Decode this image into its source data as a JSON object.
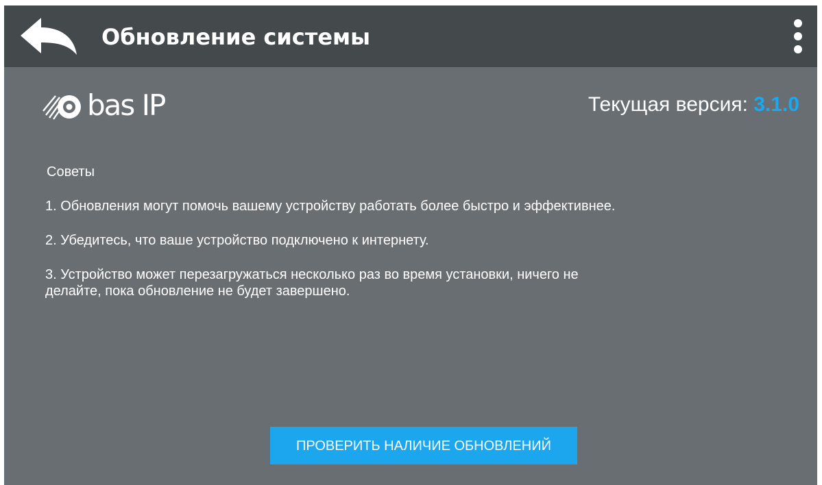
{
  "appbar": {
    "title": "Обновление системы",
    "back_icon": "back-arrow-icon",
    "menu_icon": "more-vert-icon"
  },
  "logo": {
    "text": "bas IP",
    "icon": "bas-ip-logo-icon"
  },
  "version": {
    "label": "Текущая версия: ",
    "value": "3.1.0",
    "value_color": "#1aa8f0"
  },
  "tips": {
    "title": "Советы",
    "items": [
      " 1. Обновления могут помочь вашему устройству работать более быстро и эффективнее.",
      " 2. Убедитесь, что ваше устройство подключено к интернету.",
      " 3. Устройство может перезагружаться несколько раз во время установки, ничего не\nделайте, пока обновление не будет завершено."
    ]
  },
  "check_button": {
    "label": "ПРОВЕРИТЬ НАЛИЧИЕ ОБНОВЛЕНИЙ",
    "color": "#1ba6ee"
  },
  "colors": {
    "appbar": "#44494c",
    "background": "#686e72",
    "text": "#ffffff"
  }
}
